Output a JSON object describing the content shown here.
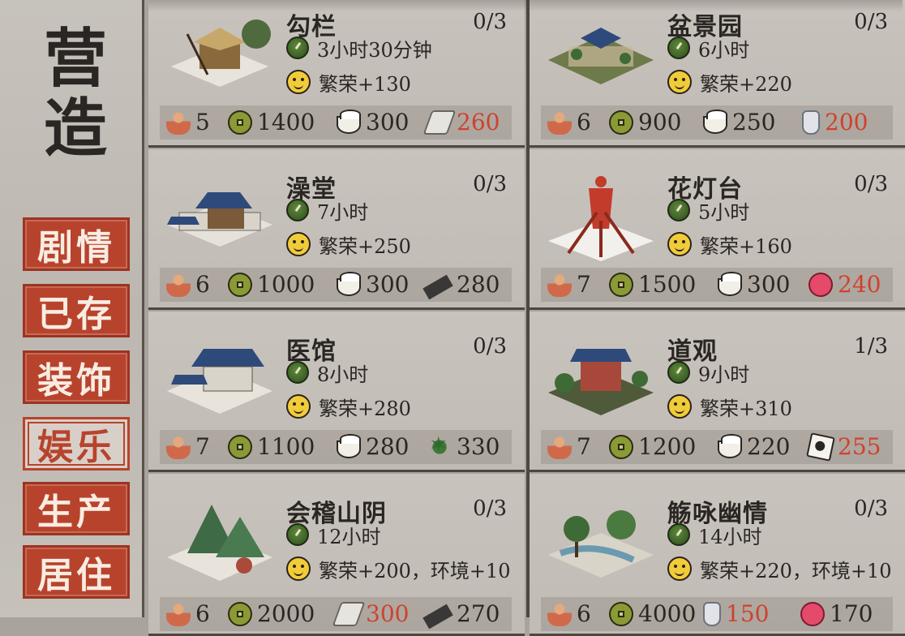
{
  "panel": {
    "title": "营造",
    "categories": [
      {
        "label": "剧情",
        "active": false
      },
      {
        "label": "已存",
        "active": false
      },
      {
        "label": "装饰",
        "active": false
      },
      {
        "label": "娱乐",
        "active": true
      },
      {
        "label": "生产",
        "active": false
      },
      {
        "label": "居住",
        "active": false
      }
    ]
  },
  "cards": [
    {
      "name": "勾栏",
      "count": "0/3",
      "time": "3小时30分钟",
      "prosperity": "繁荣+130",
      "costs": {
        "workers": "5",
        "coins": "1400",
        "food": "300",
        "material": "260",
        "material_icon": "cloth-icon",
        "material_red": true
      }
    },
    {
      "name": "盆景园",
      "count": "0/3",
      "time": "6小时",
      "prosperity": "繁荣+220",
      "costs": {
        "workers": "6",
        "coins": "900",
        "food": "250",
        "material": "200",
        "material_icon": "bottle-icon",
        "material_red": true
      }
    },
    {
      "name": "澡堂",
      "count": "0/3",
      "time": "7小时",
      "prosperity": "繁荣+250",
      "costs": {
        "workers": "6",
        "coins": "1000",
        "food": "300",
        "material": "280",
        "material_icon": "ink-icon",
        "material_red": false
      }
    },
    {
      "name": "花灯台",
      "count": "0/3",
      "time": "5小时",
      "prosperity": "繁荣+160",
      "costs": {
        "workers": "7",
        "coins": "1500",
        "food": "300",
        "material": "240",
        "material_icon": "seal-icon",
        "material_red": true
      }
    },
    {
      "name": "医馆",
      "count": "0/3",
      "time": "8小时",
      "prosperity": "繁荣+280",
      "costs": {
        "workers": "7",
        "coins": "1100",
        "food": "280",
        "material": "330",
        "material_icon": "herb-icon",
        "material_red": false
      }
    },
    {
      "name": "道观",
      "count": "1/3",
      "time": "9小时",
      "prosperity": "繁荣+310",
      "costs": {
        "workers": "7",
        "coins": "1200",
        "food": "220",
        "material": "255",
        "material_icon": "paper-icon",
        "material_red": true
      }
    },
    {
      "name": "会稽山阴",
      "count": "0/3",
      "time": "12小时",
      "prosperity": "繁荣+200，环境+10",
      "costs": {
        "workers": "6",
        "coins": "2000",
        "food": "",
        "material": "300",
        "material_icon": "cloth-icon",
        "material_red": true,
        "extra": "270"
      }
    },
    {
      "name": "觞咏幽情",
      "count": "0/3",
      "time": "14小时",
      "prosperity": "繁荣+220，环境+10",
      "costs": {
        "workers": "6",
        "coins": "4000",
        "food": "",
        "material": "150",
        "material_icon": "bottle-icon",
        "material_red": true,
        "extra": "170"
      }
    }
  ],
  "colors": {
    "accent": "#b8432d",
    "red_value": "#d0412d",
    "paper": "#c6c0ba"
  }
}
